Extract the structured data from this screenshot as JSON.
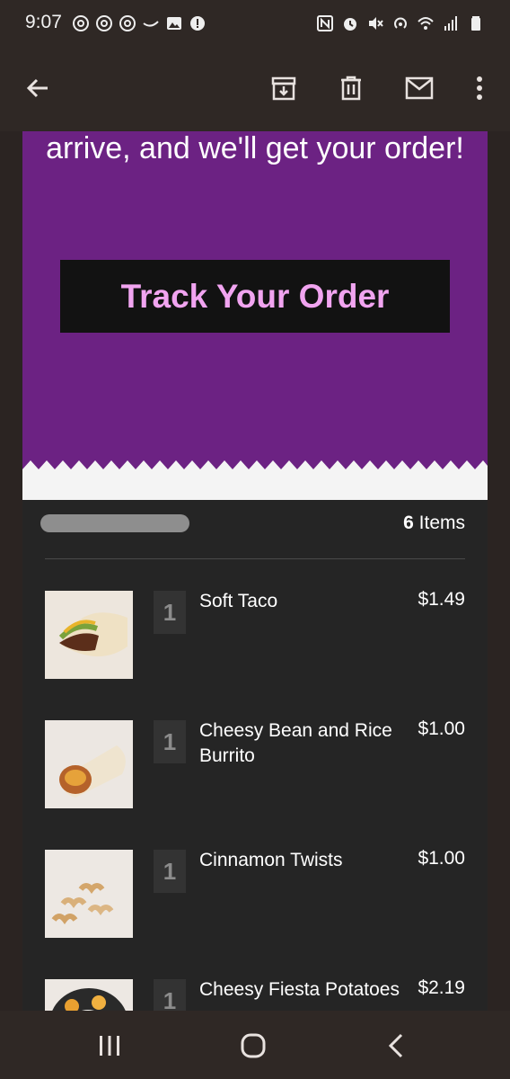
{
  "status_bar": {
    "time": "9:07",
    "left_icons": [
      "threads-icon",
      "threads-icon",
      "threads-icon",
      "chevron-icon",
      "gallery-icon",
      "alert-icon"
    ],
    "right_icons": [
      "nfc-icon",
      "alarm-icon",
      "mute-icon",
      "hotspot-icon",
      "wifi-icon",
      "signal-icon",
      "battery-icon"
    ]
  },
  "app_bar": {
    "icons": [
      "back-arrow-icon",
      "archive-icon",
      "trash-icon",
      "mail-icon",
      "more-vert-icon"
    ]
  },
  "email": {
    "hero_text": "arrive, and we'll get your order!",
    "track_button": "Track Your Order",
    "colors": {
      "hero_bg": "#6c2283",
      "button_bg": "#121212",
      "button_text": "#f1a4f0"
    },
    "items_count_number": "6",
    "items_count_label": "Items",
    "items": [
      {
        "qty": "1",
        "name": "Soft Taco",
        "price": "$1.49",
        "image": "soft-taco-image"
      },
      {
        "qty": "1",
        "name": "Cheesy Bean and Rice Burrito",
        "price": "$1.00",
        "image": "burrito-image"
      },
      {
        "qty": "1",
        "name": "Cinnamon Twists",
        "price": "$1.00",
        "image": "cinnamon-twists-image"
      },
      {
        "qty": "1",
        "name": "Cheesy Fiesta Potatoes",
        "price": "$2.19",
        "image": "fiesta-potatoes-image"
      }
    ]
  },
  "nav_bar": {
    "icons": [
      "recents-icon",
      "home-icon",
      "nav-back-icon"
    ]
  }
}
